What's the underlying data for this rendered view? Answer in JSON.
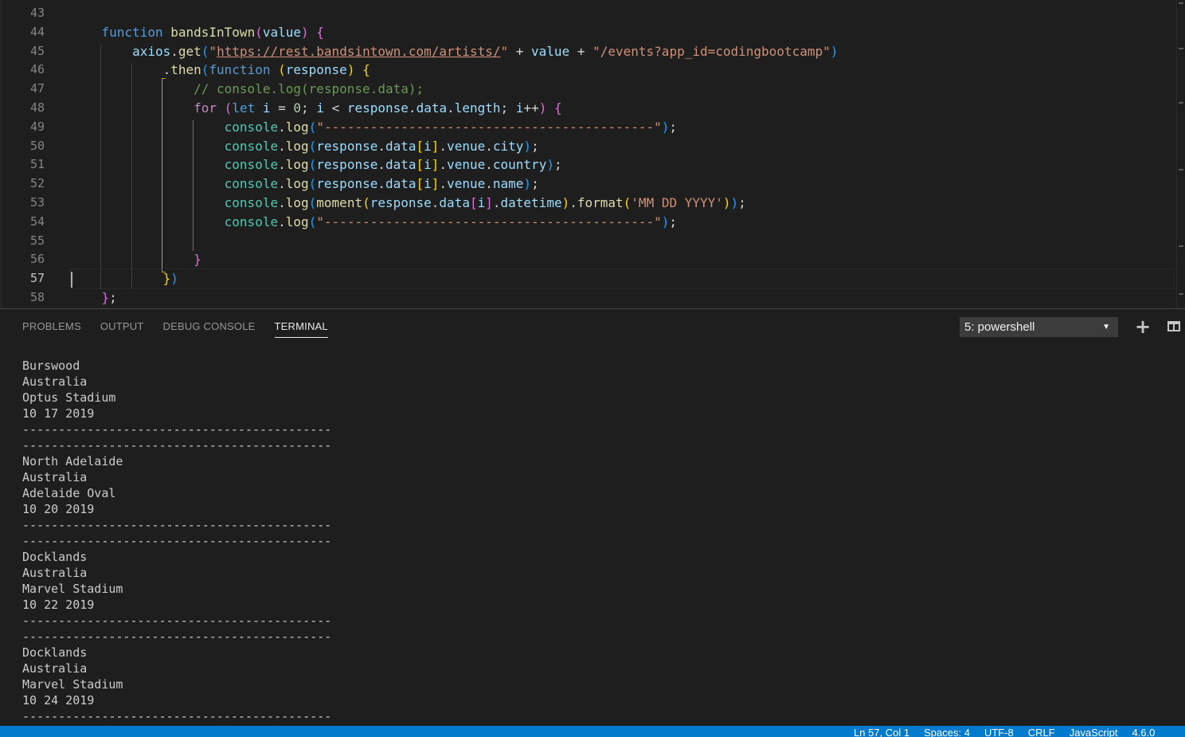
{
  "editor": {
    "line_numbers": [
      "43",
      "44",
      "45",
      "46",
      "47",
      "48",
      "49",
      "50",
      "51",
      "52",
      "53",
      "54",
      "55",
      "56",
      "57",
      "58"
    ],
    "active_line": "57",
    "lines": [
      [],
      [
        [
          "    ",
          "pu"
        ],
        [
          "function",
          "kw"
        ],
        [
          " ",
          "pu"
        ],
        [
          "bandsInTown",
          "fn"
        ],
        [
          "(",
          "b2"
        ],
        [
          "value",
          "vr"
        ],
        [
          ")",
          "b2"
        ],
        [
          " ",
          "pu"
        ],
        [
          "{",
          "b2"
        ]
      ],
      [
        [
          "        ",
          "pu"
        ],
        [
          "axios",
          "vr"
        ],
        [
          ".",
          "pu"
        ],
        [
          "get",
          "fn"
        ],
        [
          "(",
          "b3"
        ],
        [
          "\"",
          "st"
        ],
        [
          "https://rest.bandsintown.com/artists/",
          "url"
        ],
        [
          "\"",
          "st"
        ],
        [
          " + ",
          "pu"
        ],
        [
          "value",
          "vr"
        ],
        [
          " + ",
          "pu"
        ],
        [
          "\"/events?app_id=codingbootcamp\"",
          "st"
        ],
        [
          ")",
          "b3"
        ]
      ],
      [
        [
          "            ",
          "pu"
        ],
        [
          ".",
          "pu"
        ],
        [
          "then",
          "fn"
        ],
        [
          "(",
          "b3"
        ],
        [
          "function",
          "kw"
        ],
        [
          " ",
          "pu"
        ],
        [
          "(",
          "b1"
        ],
        [
          "response",
          "vr"
        ],
        [
          ")",
          "b1"
        ],
        [
          " ",
          "pu"
        ],
        [
          "{",
          "b1"
        ]
      ],
      [
        [
          "                ",
          "pu"
        ],
        [
          "// console.log(response.data);",
          "cm"
        ]
      ],
      [
        [
          "                ",
          "pu"
        ],
        [
          "for",
          "cx"
        ],
        [
          " ",
          "pu"
        ],
        [
          "(",
          "b2"
        ],
        [
          "let",
          "kw"
        ],
        [
          " ",
          "pu"
        ],
        [
          "i",
          "vr"
        ],
        [
          " = ",
          "pu"
        ],
        [
          "0",
          "nm"
        ],
        [
          "; ",
          "pu"
        ],
        [
          "i",
          "vr"
        ],
        [
          " < ",
          "pu"
        ],
        [
          "response",
          "vr"
        ],
        [
          ".",
          "pu"
        ],
        [
          "data",
          "vr"
        ],
        [
          ".",
          "pu"
        ],
        [
          "length",
          "vr"
        ],
        [
          "; ",
          "pu"
        ],
        [
          "i",
          "vr"
        ],
        [
          "++",
          "pu"
        ],
        [
          ")",
          "b2"
        ],
        [
          " ",
          "pu"
        ],
        [
          "{",
          "b2"
        ]
      ],
      [
        [
          "                    ",
          "pu"
        ],
        [
          "console",
          "ob"
        ],
        [
          ".",
          "pu"
        ],
        [
          "log",
          "fn"
        ],
        [
          "(",
          "b3"
        ],
        [
          "\"-------------------------------------------\"",
          "st"
        ],
        [
          ")",
          "b3"
        ],
        [
          ";",
          "pu"
        ]
      ],
      [
        [
          "                    ",
          "pu"
        ],
        [
          "console",
          "ob"
        ],
        [
          ".",
          "pu"
        ],
        [
          "log",
          "fn"
        ],
        [
          "(",
          "b3"
        ],
        [
          "response",
          "vr"
        ],
        [
          ".",
          "pu"
        ],
        [
          "data",
          "vr"
        ],
        [
          "[",
          "b1"
        ],
        [
          "i",
          "vr"
        ],
        [
          "]",
          "b1"
        ],
        [
          ".",
          "pu"
        ],
        [
          "venue",
          "vr"
        ],
        [
          ".",
          "pu"
        ],
        [
          "city",
          "vr"
        ],
        [
          ")",
          "b3"
        ],
        [
          ";",
          "pu"
        ]
      ],
      [
        [
          "                    ",
          "pu"
        ],
        [
          "console",
          "ob"
        ],
        [
          ".",
          "pu"
        ],
        [
          "log",
          "fn"
        ],
        [
          "(",
          "b3"
        ],
        [
          "response",
          "vr"
        ],
        [
          ".",
          "pu"
        ],
        [
          "data",
          "vr"
        ],
        [
          "[",
          "b1"
        ],
        [
          "i",
          "vr"
        ],
        [
          "]",
          "b1"
        ],
        [
          ".",
          "pu"
        ],
        [
          "venue",
          "vr"
        ],
        [
          ".",
          "pu"
        ],
        [
          "country",
          "vr"
        ],
        [
          ")",
          "b3"
        ],
        [
          ";",
          "pu"
        ]
      ],
      [
        [
          "                    ",
          "pu"
        ],
        [
          "console",
          "ob"
        ],
        [
          ".",
          "pu"
        ],
        [
          "log",
          "fn"
        ],
        [
          "(",
          "b3"
        ],
        [
          "response",
          "vr"
        ],
        [
          ".",
          "pu"
        ],
        [
          "data",
          "vr"
        ],
        [
          "[",
          "b1"
        ],
        [
          "i",
          "vr"
        ],
        [
          "]",
          "b1"
        ],
        [
          ".",
          "pu"
        ],
        [
          "venue",
          "vr"
        ],
        [
          ".",
          "pu"
        ],
        [
          "name",
          "vr"
        ],
        [
          ")",
          "b3"
        ],
        [
          ";",
          "pu"
        ]
      ],
      [
        [
          "                    ",
          "pu"
        ],
        [
          "console",
          "ob"
        ],
        [
          ".",
          "pu"
        ],
        [
          "log",
          "fn"
        ],
        [
          "(",
          "b3"
        ],
        [
          "moment",
          "fn"
        ],
        [
          "(",
          "b1"
        ],
        [
          "response",
          "vr"
        ],
        [
          ".",
          "pu"
        ],
        [
          "data",
          "vr"
        ],
        [
          "[",
          "b2"
        ],
        [
          "i",
          "vr"
        ],
        [
          "]",
          "b2"
        ],
        [
          ".",
          "pu"
        ],
        [
          "datetime",
          "vr"
        ],
        [
          ")",
          "b1"
        ],
        [
          ".",
          "pu"
        ],
        [
          "format",
          "fn"
        ],
        [
          "(",
          "b1"
        ],
        [
          "'MM DD YYYY'",
          "st"
        ],
        [
          ")",
          "b1"
        ],
        [
          ")",
          "b3"
        ],
        [
          ";",
          "pu"
        ]
      ],
      [
        [
          "                    ",
          "pu"
        ],
        [
          "console",
          "ob"
        ],
        [
          ".",
          "pu"
        ],
        [
          "log",
          "fn"
        ],
        [
          "(",
          "b3"
        ],
        [
          "\"-------------------------------------------\"",
          "st"
        ],
        [
          ")",
          "b3"
        ],
        [
          ";",
          "pu"
        ]
      ],
      [],
      [
        [
          "                ",
          "pu"
        ],
        [
          "}",
          "b2"
        ]
      ],
      [
        [
          "            ",
          "pu"
        ],
        [
          "}",
          "b1"
        ],
        [
          ")",
          "b3"
        ]
      ],
      [
        [
          "    ",
          "pu"
        ],
        [
          "}",
          "b2"
        ],
        [
          ";",
          "pu"
        ]
      ]
    ]
  },
  "panel": {
    "tabs": [
      "PROBLEMS",
      "OUTPUT",
      "DEBUG CONSOLE",
      "TERMINAL"
    ],
    "active_tab": "TERMINAL",
    "terminal_select": "5: powershell",
    "new_terminal_icon": "plus-icon",
    "split_terminal_icon": "split-icon",
    "terminal_lines": [
      "Burswood",
      "Australia",
      "Optus Stadium",
      "10 17 2019",
      "-------------------------------------------",
      "-------------------------------------------",
      "North Adelaide",
      "Australia",
      "Adelaide Oval",
      "10 20 2019",
      "-------------------------------------------",
      "-------------------------------------------",
      "Docklands",
      "Australia",
      "Marvel Stadium",
      "10 22 2019",
      "-------------------------------------------",
      "-------------------------------------------",
      "Docklands",
      "Australia",
      "Marvel Stadium",
      "10 24 2019",
      "-------------------------------------------"
    ]
  },
  "statusbar": {
    "position": "Ln 57, Col 1",
    "spaces": "Spaces: 4",
    "encoding": "UTF-8",
    "eol": "CRLF",
    "language": "JavaScript",
    "version": "4.6.0"
  },
  "colors": {
    "accent": "#007acc",
    "background": "#1e1e1e",
    "bracket_box": "#c8a400"
  }
}
